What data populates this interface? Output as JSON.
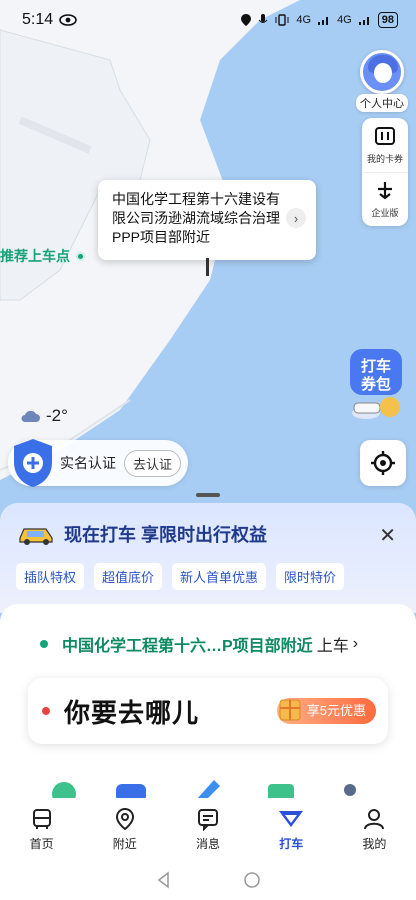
{
  "status_bar": {
    "time": "5:14",
    "network": "4G",
    "battery": "98"
  },
  "map": {
    "popup_address": "中国化学工程第十六建设有限公司汤逊湖流域综合治理PPP项目部附近",
    "recommend_label": "推荐上车点",
    "weather": "-2°"
  },
  "side_tools": {
    "profile_label": "个人中心",
    "coupon_label": "我的卡券",
    "enterprise_label": "企业版",
    "pack_label": "打车券包"
  },
  "verify": {
    "label": "实名认证",
    "button": "去认证"
  },
  "promo": {
    "title": "现在打车 享限时出行权益",
    "chips": [
      "插队特权",
      "超值底价",
      "新人首单优惠",
      "限时特价"
    ]
  },
  "ride": {
    "pickup": "中国化学工程第十六…P项目部附近",
    "pickup_suffix": "上车",
    "destination_prompt": "你要去哪儿",
    "discount": "享5元优惠"
  },
  "nav": {
    "items": [
      {
        "label": "首页",
        "icon": "bus-icon"
      },
      {
        "label": "附近",
        "icon": "location-pin-icon"
      },
      {
        "label": "消息",
        "icon": "message-icon"
      },
      {
        "label": "打车",
        "icon": "taxi-icon"
      },
      {
        "label": "我的",
        "icon": "person-icon"
      }
    ],
    "active": "打车"
  },
  "colors": {
    "water": "#a8cdf4",
    "accent": "#2b4fd6",
    "green": "#16a37a",
    "red": "#e64545"
  }
}
